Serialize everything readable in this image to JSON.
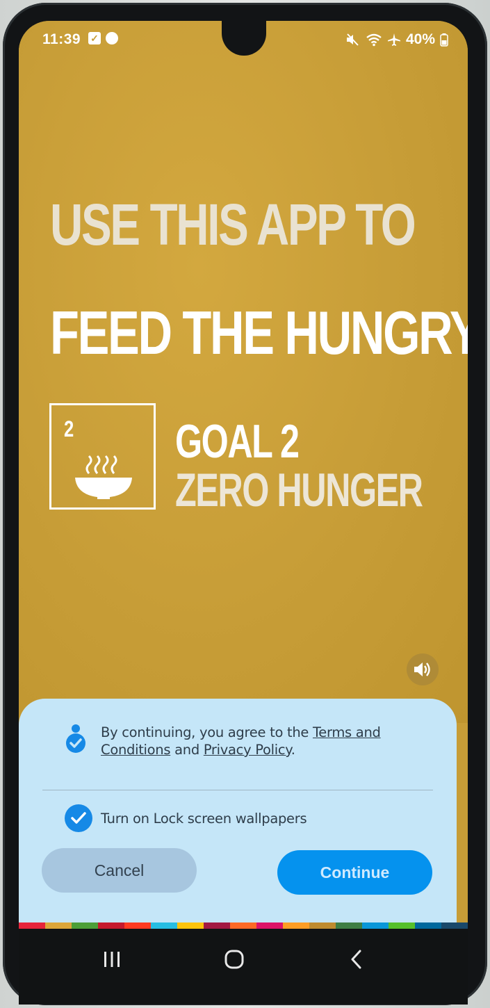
{
  "status_bar": {
    "time": "11:39",
    "battery": "40%",
    "left_icons": [
      "checkbox-notification-icon",
      "face-notification-icon"
    ],
    "right_icons": [
      "mute-icon",
      "wifi-icon",
      "airplane-mode-icon",
      "battery-icon"
    ]
  },
  "wallpaper": {
    "headline_1": "USE THIS APP TO",
    "headline_2": "FEED THE HUNGRY",
    "goal_number": "2",
    "goal_title_1": "GOAL 2",
    "goal_title_2": "ZERO HUNGER",
    "background_color": "#c79d37"
  },
  "sheet": {
    "terms_prefix": "By continuing, you agree to the ",
    "terms_link": "Terms and Conditions",
    "terms_middle": " and ",
    "privacy_link": "Privacy Policy",
    "terms_suffix": ".",
    "lock_screen_label": "Turn on Lock screen wallpapers",
    "lock_screen_checked": true,
    "cancel_label": "Cancel",
    "continue_label": "Continue",
    "accent_color": "#0592ee"
  },
  "sdg_colors": [
    "#e5243b",
    "#dda63a",
    "#4c9f38",
    "#c5192d",
    "#ff3a21",
    "#26bde2",
    "#fcc30b",
    "#a21942",
    "#fd6925",
    "#dd1367",
    "#fd9d24",
    "#bf8b2e",
    "#3f7e44",
    "#0a97d9",
    "#56c02b",
    "#00689d",
    "#19486a"
  ]
}
